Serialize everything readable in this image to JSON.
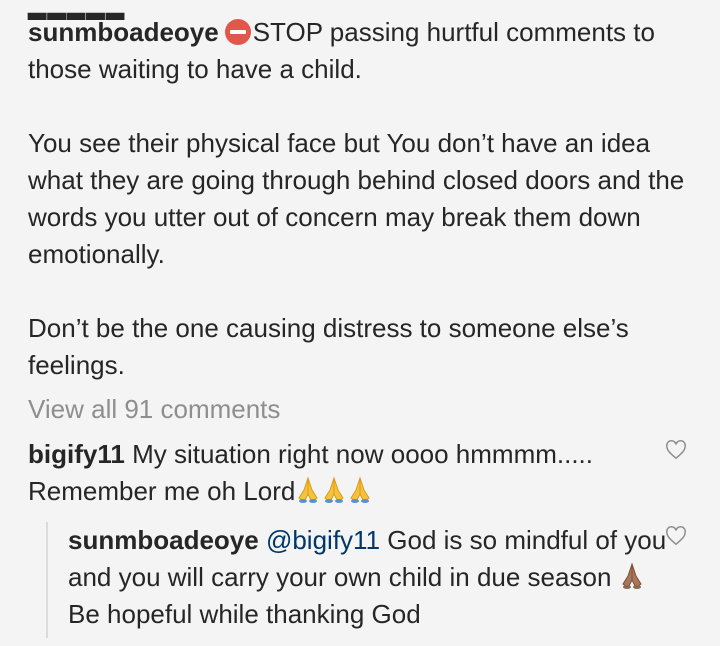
{
  "caption": {
    "username": "sunmboadeoye",
    "stop_emoji": "no-entry-icon",
    "line1": "STOP passing hurtful comments to those waiting to have a child.",
    "paragraph2": "You see their physical face but You don’t have an idea what they are going through behind closed doors and the words you utter out of concern may break them down emotionally.",
    "paragraph3": "Don’t be the one causing distress to someone else’s feelings."
  },
  "view_all_comments": "View all 91 comments",
  "comments": [
    {
      "username": "bigify11",
      "text": "My situation right now oooo hmmmm..... Remember me oh Lord",
      "emojis": [
        "folded-hands-icon",
        "folded-hands-icon",
        "folded-hands-icon"
      ],
      "emoji_color": "#f5c33b"
    }
  ],
  "reply": {
    "username": "sunmboadeoye",
    "mention": "@bigify11",
    "text_before_emoji": "God is so mindful of you and you will carry your own child in due season",
    "emoji": "folded-hands-medium-dark-icon",
    "emoji_color": "#a9765a",
    "text_after_emoji": "Be hopeful while thanking God"
  },
  "colors": {
    "background": "#f4f4f4",
    "text": "#262626",
    "muted": "#8e8e8e",
    "mention": "#00376b",
    "stop_red": "#e2574c"
  }
}
